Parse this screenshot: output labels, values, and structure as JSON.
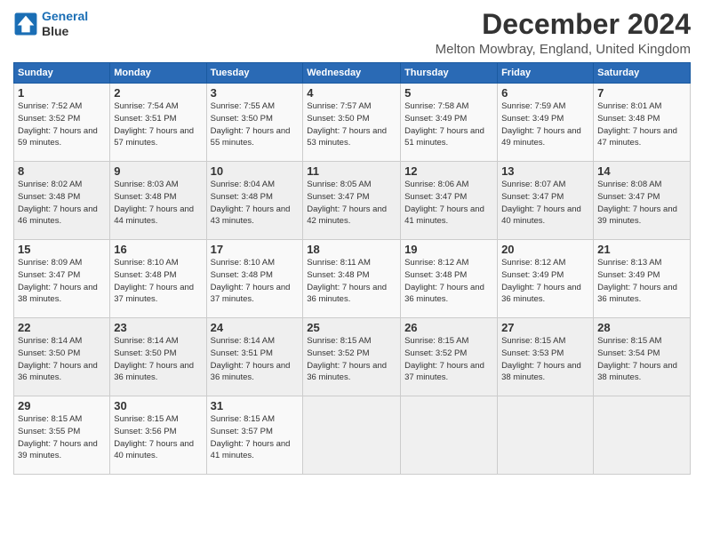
{
  "header": {
    "logo_line1": "General",
    "logo_line2": "Blue",
    "title": "December 2024",
    "subtitle": "Melton Mowbray, England, United Kingdom"
  },
  "calendar": {
    "weekdays": [
      "Sunday",
      "Monday",
      "Tuesday",
      "Wednesday",
      "Thursday",
      "Friday",
      "Saturday"
    ],
    "weeks": [
      [
        {
          "day": "1",
          "rise": "7:52 AM",
          "set": "3:52 PM",
          "daylight": "7 hours and 59 minutes."
        },
        {
          "day": "2",
          "rise": "7:54 AM",
          "set": "3:51 PM",
          "daylight": "7 hours and 57 minutes."
        },
        {
          "day": "3",
          "rise": "7:55 AM",
          "set": "3:50 PM",
          "daylight": "7 hours and 55 minutes."
        },
        {
          "day": "4",
          "rise": "7:57 AM",
          "set": "3:50 PM",
          "daylight": "7 hours and 53 minutes."
        },
        {
          "day": "5",
          "rise": "7:58 AM",
          "set": "3:49 PM",
          "daylight": "7 hours and 51 minutes."
        },
        {
          "day": "6",
          "rise": "7:59 AM",
          "set": "3:49 PM",
          "daylight": "7 hours and 49 minutes."
        },
        {
          "day": "7",
          "rise": "8:01 AM",
          "set": "3:48 PM",
          "daylight": "7 hours and 47 minutes."
        }
      ],
      [
        {
          "day": "8",
          "rise": "8:02 AM",
          "set": "3:48 PM",
          "daylight": "7 hours and 46 minutes."
        },
        {
          "day": "9",
          "rise": "8:03 AM",
          "set": "3:48 PM",
          "daylight": "7 hours and 44 minutes."
        },
        {
          "day": "10",
          "rise": "8:04 AM",
          "set": "3:48 PM",
          "daylight": "7 hours and 43 minutes."
        },
        {
          "day": "11",
          "rise": "8:05 AM",
          "set": "3:47 PM",
          "daylight": "7 hours and 42 minutes."
        },
        {
          "day": "12",
          "rise": "8:06 AM",
          "set": "3:47 PM",
          "daylight": "7 hours and 41 minutes."
        },
        {
          "day": "13",
          "rise": "8:07 AM",
          "set": "3:47 PM",
          "daylight": "7 hours and 40 minutes."
        },
        {
          "day": "14",
          "rise": "8:08 AM",
          "set": "3:47 PM",
          "daylight": "7 hours and 39 minutes."
        }
      ],
      [
        {
          "day": "15",
          "rise": "8:09 AM",
          "set": "3:47 PM",
          "daylight": "7 hours and 38 minutes."
        },
        {
          "day": "16",
          "rise": "8:10 AM",
          "set": "3:48 PM",
          "daylight": "7 hours and 37 minutes."
        },
        {
          "day": "17",
          "rise": "8:10 AM",
          "set": "3:48 PM",
          "daylight": "7 hours and 37 minutes."
        },
        {
          "day": "18",
          "rise": "8:11 AM",
          "set": "3:48 PM",
          "daylight": "7 hours and 36 minutes."
        },
        {
          "day": "19",
          "rise": "8:12 AM",
          "set": "3:48 PM",
          "daylight": "7 hours and 36 minutes."
        },
        {
          "day": "20",
          "rise": "8:12 AM",
          "set": "3:49 PM",
          "daylight": "7 hours and 36 minutes."
        },
        {
          "day": "21",
          "rise": "8:13 AM",
          "set": "3:49 PM",
          "daylight": "7 hours and 36 minutes."
        }
      ],
      [
        {
          "day": "22",
          "rise": "8:14 AM",
          "set": "3:50 PM",
          "daylight": "7 hours and 36 minutes."
        },
        {
          "day": "23",
          "rise": "8:14 AM",
          "set": "3:50 PM",
          "daylight": "7 hours and 36 minutes."
        },
        {
          "day": "24",
          "rise": "8:14 AM",
          "set": "3:51 PM",
          "daylight": "7 hours and 36 minutes."
        },
        {
          "day": "25",
          "rise": "8:15 AM",
          "set": "3:52 PM",
          "daylight": "7 hours and 36 minutes."
        },
        {
          "day": "26",
          "rise": "8:15 AM",
          "set": "3:52 PM",
          "daylight": "7 hours and 37 minutes."
        },
        {
          "day": "27",
          "rise": "8:15 AM",
          "set": "3:53 PM",
          "daylight": "7 hours and 38 minutes."
        },
        {
          "day": "28",
          "rise": "8:15 AM",
          "set": "3:54 PM",
          "daylight": "7 hours and 38 minutes."
        }
      ],
      [
        {
          "day": "29",
          "rise": "8:15 AM",
          "set": "3:55 PM",
          "daylight": "7 hours and 39 minutes."
        },
        {
          "day": "30",
          "rise": "8:15 AM",
          "set": "3:56 PM",
          "daylight": "7 hours and 40 minutes."
        },
        {
          "day": "31",
          "rise": "8:15 AM",
          "set": "3:57 PM",
          "daylight": "7 hours and 41 minutes."
        },
        null,
        null,
        null,
        null
      ]
    ]
  }
}
